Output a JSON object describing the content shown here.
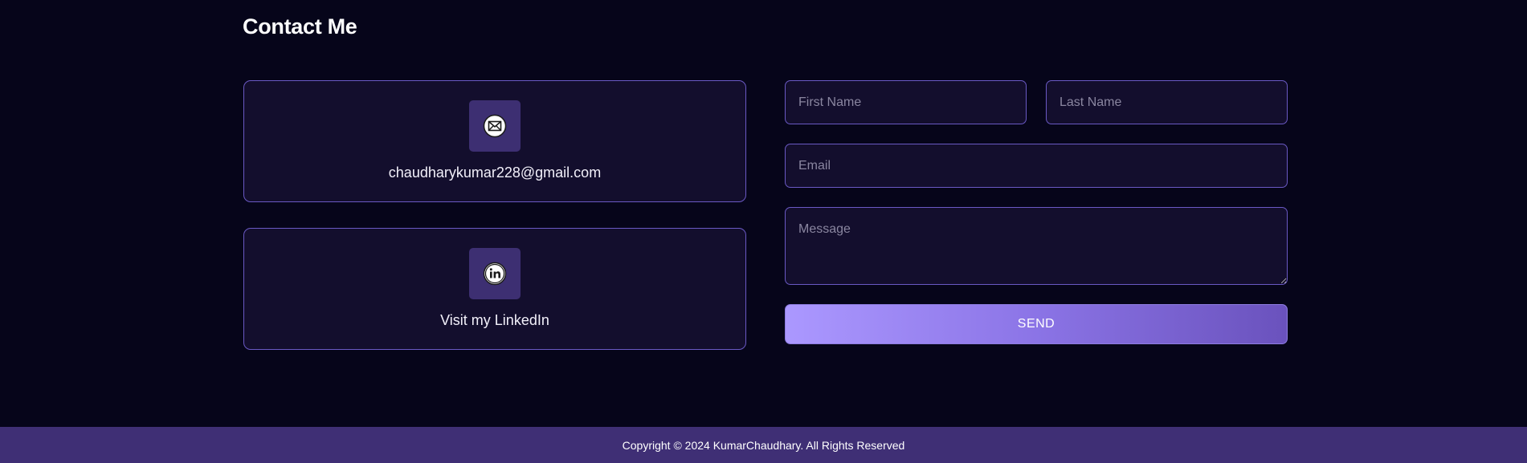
{
  "section": {
    "title": "Contact Me"
  },
  "contacts": {
    "email": {
      "label": "chaudharykumar228@gmail.com",
      "icon": "envelope-icon"
    },
    "linkedin": {
      "label": "Visit my LinkedIn",
      "icon": "linkedin-icon"
    }
  },
  "form": {
    "first_name": {
      "placeholder": "First Name",
      "value": ""
    },
    "last_name": {
      "placeholder": "Last Name",
      "value": ""
    },
    "email": {
      "placeholder": "Email",
      "value": ""
    },
    "message": {
      "placeholder": "Message",
      "value": ""
    },
    "send_label": "SEND"
  },
  "footer": {
    "copyright": "Copyright © 2024 KumarChaudhary. All Rights Reserved"
  },
  "colors": {
    "background": "#06051a",
    "card": "#130e2d",
    "border": "#6a59c4",
    "accent": "#ab98ff",
    "footer": "#3f2f75"
  }
}
